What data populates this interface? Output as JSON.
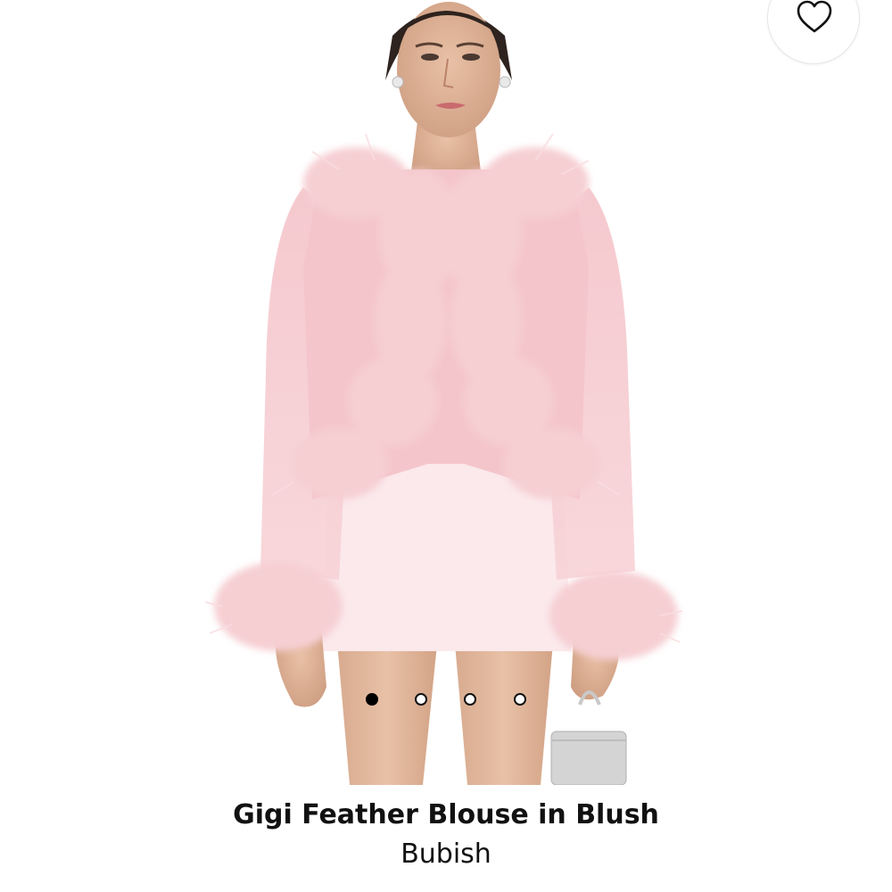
{
  "product": {
    "title": "Gigi Feather Blouse in Blush",
    "brand": "Bubish"
  },
  "gallery": {
    "total_images": 4,
    "active_index": 0
  },
  "wishlist": {
    "icon": "heart-outline-icon"
  },
  "colors": {
    "background": "#ffffff",
    "blouse": "#f4c6cb",
    "feather": "#f6cfd3",
    "skirt": "#fbe9ec",
    "text": "#111111"
  }
}
